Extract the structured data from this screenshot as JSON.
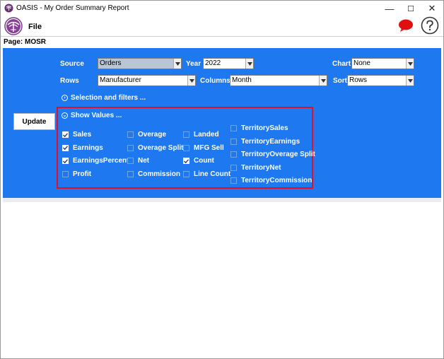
{
  "window": {
    "title": "OASIS - My Order Summary Report",
    "minimize_glyph": "—",
    "maximize_glyph": "☐",
    "close_glyph": "✕"
  },
  "menu": {
    "file_label": "File"
  },
  "page": {
    "label": "Page:  MOSR"
  },
  "controls": {
    "source_label": "Source",
    "source_value": "Orders",
    "year_label": "Year",
    "year_value": "2022",
    "chart_label": "Chart",
    "chart_value": "None",
    "rows_label": "Rows",
    "rows_value": "Manufacturer",
    "columns_label": "Columns",
    "columns_value": "Month",
    "sort_label": "Sort",
    "sort_value": "Rows",
    "selection_label": "Selection and filters ...",
    "show_values_label": "Show Values ...",
    "update_label": "Update"
  },
  "values": {
    "col1": [
      {
        "label": "Sales",
        "checked": true
      },
      {
        "label": "Earnings",
        "checked": true
      },
      {
        "label": "EarningsPercent",
        "checked": true
      },
      {
        "label": "Profit",
        "checked": false
      }
    ],
    "col2": [
      {
        "label": "Overage",
        "checked": false
      },
      {
        "label": "Overage Split",
        "checked": false
      },
      {
        "label": "Net",
        "checked": false
      },
      {
        "label": "Commission",
        "checked": false
      }
    ],
    "col3": [
      {
        "label": "Landed",
        "checked": false
      },
      {
        "label": "MFG Sell",
        "checked": false
      },
      {
        "label": "Count",
        "checked": true
      },
      {
        "label": "Line Count",
        "checked": false
      }
    ],
    "col4": [
      {
        "label": "TerritorySales",
        "checked": false
      },
      {
        "label": "TerritoryEarnings",
        "checked": false
      },
      {
        "label": "TerritoryOverage Split",
        "checked": false
      },
      {
        "label": "TerritoryNet",
        "checked": false
      },
      {
        "label": "TerritoryCommission",
        "checked": false
      }
    ]
  },
  "colors": {
    "panel": "#1e78f0",
    "highlight": "#e0102a",
    "chat": "#e01010"
  },
  "icons": [
    "oasis-app-icon",
    "palm-logo-icon",
    "chat-bubble-icon",
    "help-icon",
    "chevron-down-icon",
    "expand-circle-icon",
    "check-icon"
  ]
}
